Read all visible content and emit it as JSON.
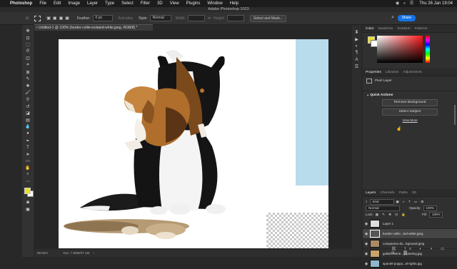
{
  "menubar": {
    "apple": "",
    "items": [
      "Photoshop",
      "File",
      "Edit",
      "Image",
      "Layer",
      "Type",
      "Select",
      "Filter",
      "3D",
      "View",
      "Plugins",
      "Window",
      "Help"
    ],
    "datetime": "Thu 26 Jan  19:04"
  },
  "window_title": "Adobe Photoshop 2023",
  "options": {
    "feather_label": "Feather:",
    "feather_value": "0 px",
    "antialias_label": "Anti-alias",
    "style_label": "Style:",
    "style_value": "Normal",
    "width_label": "Width:",
    "height_label": "Height:",
    "select_mask": "Select and Mask...",
    "share": "Share"
  },
  "document": {
    "tab": "Untitled-1 @ 100% (border-collie-isolated-white.jpeg, RGB/8) *",
    "zoom": "99.66%",
    "doc_info": "Doc: 7.98M/37.1M"
  },
  "color_panel": {
    "tabs": [
      "Color",
      "Swatches",
      "Gradient",
      "Patterns"
    ],
    "foreground": "#e8df2a",
    "background": "#ffffff"
  },
  "properties": {
    "tabs": [
      "Properties",
      "Libraries",
      "Adjustments"
    ],
    "kind": "Pixel Layer",
    "quick_actions_title": "Quick Actions",
    "remove_bg": "Remove Background",
    "select_subject": "Select Subject",
    "view_more": "View More"
  },
  "layers_panel": {
    "tabs": [
      "Layers",
      "Channels",
      "Paths",
      "3D"
    ],
    "kind_filter": "Kind",
    "blend_mode": "Normal",
    "opacity_label": "Opacity:",
    "opacity_value": "100%",
    "lock_label": "Lock:",
    "fill_label": "Fill:",
    "fill_value": "100%",
    "layers": [
      {
        "name": "Layer 1",
        "selected": false
      },
      {
        "name": "border-collie...ted-white.jpeg",
        "selected": true
      },
      {
        "name": "companion-do...kground.jpeg",
        "selected": false
      },
      {
        "name": "golden-retrie...g-panting.jpg",
        "selected": false
      },
      {
        "name": "spaniel-puppy...al-rights.jpg",
        "selected": false
      }
    ]
  }
}
